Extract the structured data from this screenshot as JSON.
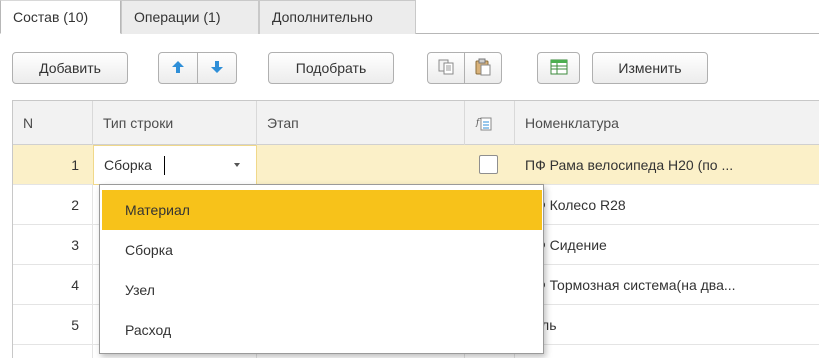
{
  "tabs": [
    {
      "label": "Состав (10)"
    },
    {
      "label": "Операции (1)"
    },
    {
      "label": "Дополнительно"
    }
  ],
  "toolbar": {
    "add_label": "Добавить",
    "pick_label": "Подобрать",
    "edit_label": "Изменить",
    "up_icon": "arrow-up-icon",
    "down_icon": "arrow-down-icon",
    "copy_icon": "copy-icon",
    "paste_icon": "paste-icon",
    "sheet_icon": "spreadsheet-icon"
  },
  "table": {
    "columns": {
      "n": "N",
      "type": "Тип строки",
      "stage": "Этап",
      "formula_icon": "formula-icon",
      "item": "Номенклатура"
    },
    "rows": [
      {
        "n": "1",
        "type": "Сборка",
        "item": "ПФ Рама велосипеда Н20 (по ..."
      },
      {
        "n": "2",
        "item": "ПФ Колесо R28"
      },
      {
        "n": "3",
        "item": "ПФ Сидение"
      },
      {
        "n": "4",
        "item": "ПФ Тормозная система(на два..."
      },
      {
        "n": "5",
        "item": "Руль"
      }
    ]
  },
  "dropdown": {
    "options": [
      "Материал",
      "Сборка",
      "Узел",
      "Расход"
    ],
    "highlighted": "Материал"
  },
  "colors": {
    "selected_row": "#fbf0c8",
    "highlight": "#f7c21a",
    "arrow_blue": "#2f8fd8"
  }
}
